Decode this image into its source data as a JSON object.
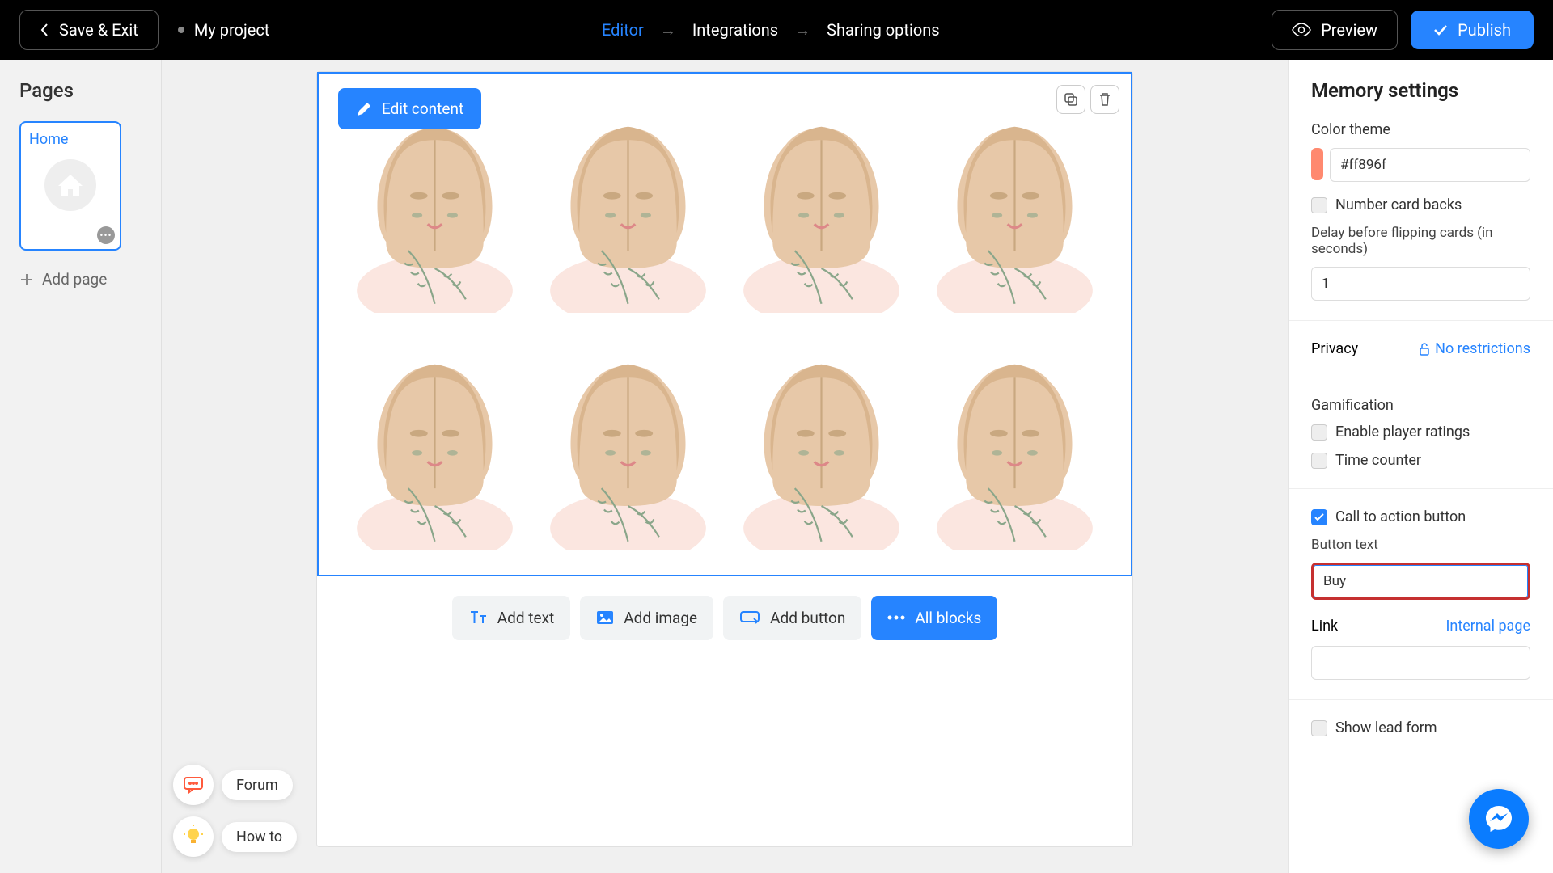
{
  "topbar": {
    "save_exit": "Save & Exit",
    "project_name": "My project",
    "tabs": {
      "editor": "Editor",
      "integrations": "Integrations",
      "sharing": "Sharing options"
    },
    "preview": "Preview",
    "publish": "Publish"
  },
  "sidebar": {
    "title": "Pages",
    "home": "Home",
    "add_page": "Add page"
  },
  "help": {
    "forum": "Forum",
    "howto": "How to"
  },
  "editor": {
    "edit_content": "Edit content",
    "add_text": "Add text",
    "add_image": "Add image",
    "add_button": "Add button",
    "all_blocks": "All blocks"
  },
  "settings": {
    "title": "Memory settings",
    "color_theme_label": "Color theme",
    "color_value": "#ff896f",
    "number_card_backs": "Number card backs",
    "delay_label": "Delay before flipping cards (in seconds)",
    "delay_value": "1",
    "privacy_label": "Privacy",
    "privacy_value": "No restrictions",
    "gamification_label": "Gamification",
    "enable_ratings": "Enable player ratings",
    "time_counter": "Time counter",
    "cta_label": "Call to action button",
    "cta_checked": true,
    "button_text_label": "Button text",
    "button_text_value": "Buy",
    "link_label": "Link",
    "link_type": "Internal page",
    "link_value": "",
    "show_lead_form": "Show lead form"
  }
}
